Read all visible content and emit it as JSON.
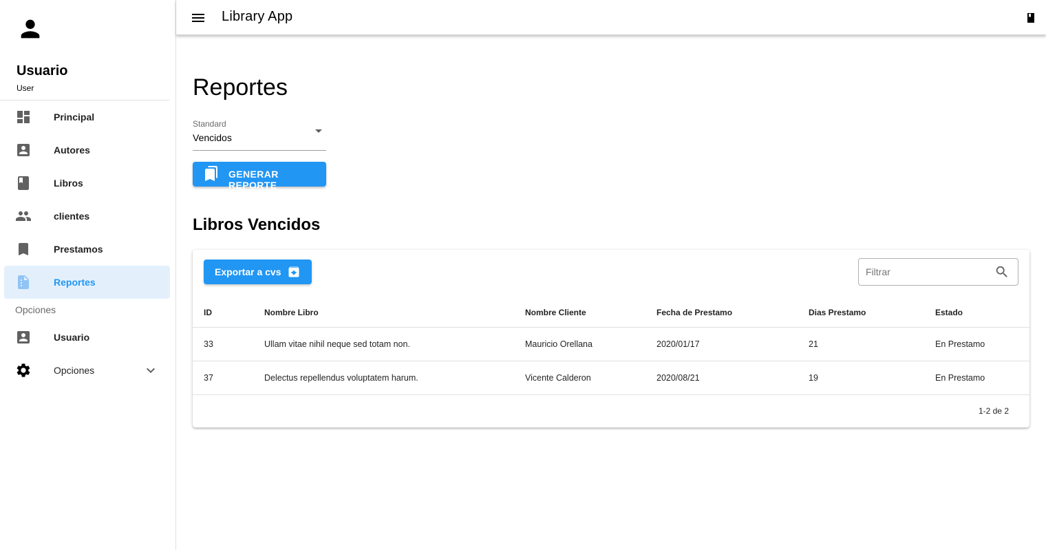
{
  "app": {
    "title": "Library App"
  },
  "user": {
    "name": "Usuario",
    "role": "User"
  },
  "sidebar": {
    "items": [
      {
        "label": "Principal",
        "icon": "dashboard-icon"
      },
      {
        "label": "Autores",
        "icon": "account-box-icon"
      },
      {
        "label": "Libros",
        "icon": "book-icon"
      },
      {
        "label": "clientes",
        "icon": "people-icon"
      },
      {
        "label": "Prestamos",
        "icon": "bookmark-icon"
      },
      {
        "label": "Reportes",
        "icon": "report-file-icon",
        "active": true
      }
    ],
    "subheader": "Opciones",
    "options": [
      {
        "label": "Usuario",
        "icon": "account-box-icon"
      },
      {
        "label": "Opciones",
        "icon": "gear-icon"
      }
    ]
  },
  "page": {
    "title": "Reportes",
    "select": {
      "label": "Standard",
      "value": "Vencidos"
    },
    "generate_button": "GENERAR REPORTE",
    "section_title": "Libros Vencidos"
  },
  "table_card": {
    "export_button": "Exportar a cvs",
    "filter_placeholder": "Filtrar",
    "columns": [
      "ID",
      "Nombre Libro",
      "Nombre Cliente",
      "Fecha de Prestamo",
      "Dias Prestamo",
      "Estado"
    ],
    "rows": [
      [
        "33",
        "Ullam vitae nihil neque sed totam non.",
        "Mauricio Orellana",
        "2020/01/17",
        "21",
        "En Prestamo"
      ],
      [
        "37",
        "Delectus repellendus voluptatem harum.",
        "Vicente Calderon",
        "2020/08/21",
        "19",
        "En Prestamo"
      ]
    ],
    "pagination": "1-2 de 2"
  },
  "colors": {
    "primary": "#2196f3",
    "active_bg": "#e3f0fc"
  }
}
